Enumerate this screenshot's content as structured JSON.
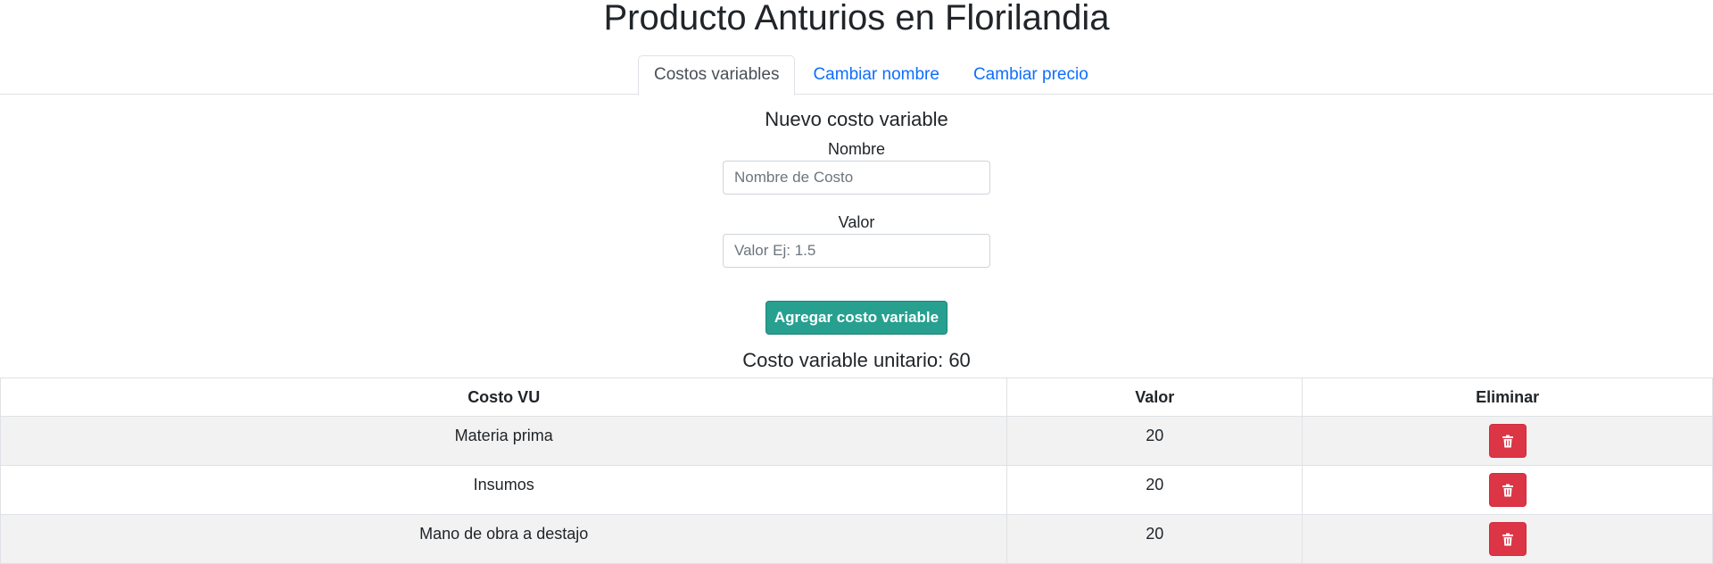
{
  "page": {
    "title": "Producto Anturios en Florilandia"
  },
  "tabs": [
    {
      "label": "Costos variables",
      "active": true
    },
    {
      "label": "Cambiar nombre",
      "active": false
    },
    {
      "label": "Cambiar precio",
      "active": false
    }
  ],
  "form": {
    "heading": "Nuevo costo variable",
    "name_label": "Nombre",
    "name_placeholder": "Nombre de Costo",
    "name_value": "",
    "value_label": "Valor",
    "value_placeholder": "Valor Ej: 1.5",
    "value_value": "",
    "submit_label": "Agregar costo variable"
  },
  "summary": {
    "text": "Costo variable unitario: 60"
  },
  "table": {
    "headers": [
      "Costo VU",
      "Valor",
      "Eliminar"
    ],
    "rows": [
      {
        "name": "Materia prima",
        "value": "20"
      },
      {
        "name": "Insumos",
        "value": "20"
      },
      {
        "name": "Mano de obra a destajo",
        "value": "20"
      }
    ]
  },
  "icons": {
    "delete": "trash-icon"
  },
  "colors": {
    "accent_link": "#0d6efd",
    "submit_button": "#27a090",
    "delete_button": "#dc3545",
    "stripe": "#f2f2f2"
  }
}
